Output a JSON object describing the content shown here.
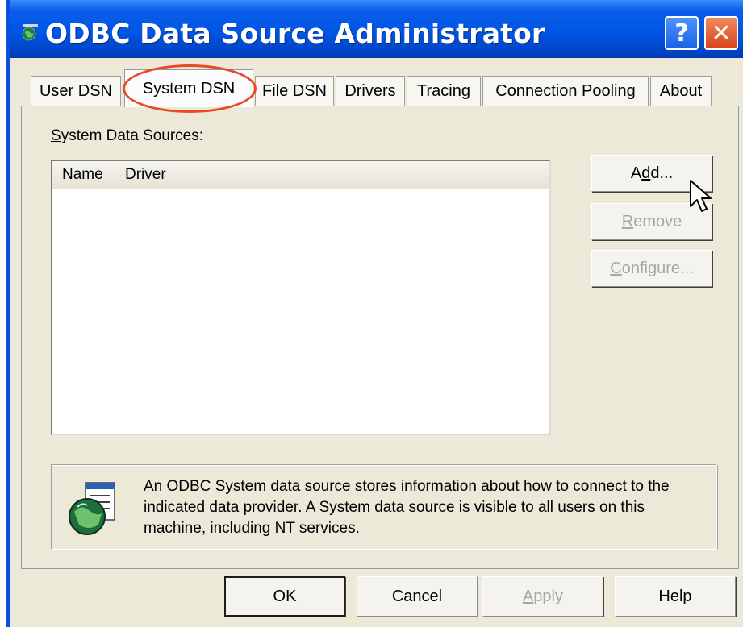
{
  "window": {
    "title": "ODBC Data Source Administrator",
    "help_glyph": "?",
    "close_glyph": "✕"
  },
  "tabs": [
    {
      "label": "User DSN",
      "active": false
    },
    {
      "label": "System DSN",
      "active": true
    },
    {
      "label": "File DSN",
      "active": false
    },
    {
      "label": "Drivers",
      "active": false
    },
    {
      "label": "Tracing",
      "active": false
    },
    {
      "label": "Connection Pooling",
      "active": false
    },
    {
      "label": "About",
      "active": false
    }
  ],
  "panel": {
    "section_label_prefix": "S",
    "section_label_rest": "ystem Data Sources:",
    "columns": [
      "Name",
      "Driver"
    ],
    "rows": [],
    "buttons": {
      "add": {
        "prefix": "A",
        "underline": "d",
        "suffix": "d...",
        "enabled": true
      },
      "remove": {
        "prefix": "",
        "underline": "R",
        "suffix": "emove",
        "enabled": false
      },
      "configure": {
        "prefix": "",
        "underline": "C",
        "suffix": "onfigure...",
        "enabled": false
      }
    },
    "info_text": "An ODBC System data source stores information about how to connect to the indicated data provider.   A System data source is visible to all users on this machine, including NT services."
  },
  "footer": {
    "ok": "OK",
    "cancel": "Cancel",
    "apply_underline": "A",
    "apply_rest": "pply",
    "help": "Help"
  },
  "colors": {
    "titlebar": "#0055e5",
    "dialog_bg": "#ece9d8",
    "highlight_circle": "#e74a23",
    "disabled_text": "#a8a79e"
  },
  "icons": [
    "odbc-globe-icon",
    "help-icon",
    "close-icon",
    "mouse-pointer-icon",
    "info-globe-icon"
  ]
}
